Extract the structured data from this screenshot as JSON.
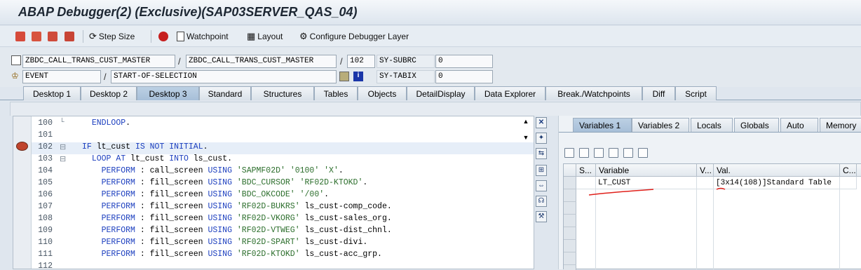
{
  "window": {
    "title": "ABAP Debugger(2)  (Exclusive)(SAP03SERVER_QAS_04)"
  },
  "toolbar": {
    "step_size_label": "Step Size",
    "watchpoint_label": "Watchpoint",
    "layout_label": "Layout",
    "configure_label": "Configure Debugger Layer"
  },
  "context": {
    "program": "ZBDC_CALL_TRANS_CUST_MASTER",
    "include": "ZBDC_CALL_TRANS_CUST_MASTER",
    "line": "102",
    "sy_subrc_label": "SY-SUBRC",
    "sy_subrc_value": "0",
    "event_type": "EVENT",
    "event_name": "START-OF-SELECTION",
    "sy_tabix_label": "SY-TABIX",
    "sy_tabix_value": "0"
  },
  "tabs": [
    "Desktop 1",
    "Desktop 2",
    "Desktop 3",
    "Standard",
    "Structures",
    "Tables",
    "Objects",
    "DetailDisplay",
    "Data Explorer",
    "Break./Watchpoints",
    "Diff",
    "Script"
  ],
  "active_tab": "Desktop 3",
  "code": {
    "lines": [
      {
        "num": "100",
        "fold": "└",
        "src": "  ENDLOOP."
      },
      {
        "num": "101",
        "fold": "",
        "src": ""
      },
      {
        "num": "102",
        "fold": "⊟",
        "src": "IF lt_cust IS NOT INITIAL."
      },
      {
        "num": "103",
        "fold": "⊟",
        "src": "  LOOP AT lt_cust INTO ls_cust."
      },
      {
        "num": "104",
        "fold": "",
        "src": "    PERFORM : call_screen USING 'SAPMF02D' '0100' 'X'."
      },
      {
        "num": "105",
        "fold": "",
        "src": "    PERFORM : fill_screen USING 'BDC_CURSOR' 'RF02D-KTOKD'."
      },
      {
        "num": "106",
        "fold": "",
        "src": "    PERFORM : fill_screen USING 'BDC_OKCODE' '/00'."
      },
      {
        "num": "107",
        "fold": "",
        "src": "    PERFORM : fill_screen USING 'RF02D-BUKRS' ls_cust-comp_code."
      },
      {
        "num": "108",
        "fold": "",
        "src": "    PERFORM : fill_screen USING 'RF02D-VKORG' ls_cust-sales_org."
      },
      {
        "num": "109",
        "fold": "",
        "src": "    PERFORM : fill_screen USING 'RF02D-VTWEG' ls_cust-dist_chnl."
      },
      {
        "num": "110",
        "fold": "",
        "src": "    PERFORM : fill_screen USING 'RF02D-SPART' ls_cust-divi."
      },
      {
        "num": "111",
        "fold": "",
        "src": "    PERFORM : fill_screen USING 'RF02D-KTOKD' ls_cust-acc_grp."
      },
      {
        "num": "112",
        "fold": "",
        "src": ""
      }
    ]
  },
  "variables": {
    "tabs": [
      "Variables 1",
      "Variables 2",
      "Locals",
      "Globals",
      "Auto",
      "Memory"
    ],
    "active_tab": "Variables 1",
    "columns": [
      "S...",
      "Variable",
      "V...",
      "Val.",
      "C..."
    ],
    "rows": [
      {
        "variable": "LT_CUST",
        "value": "[3x14(108)]Standard Table"
      }
    ]
  },
  "colors": {
    "annotation": "#e0201a",
    "active_tab": "#a7bfd8"
  }
}
